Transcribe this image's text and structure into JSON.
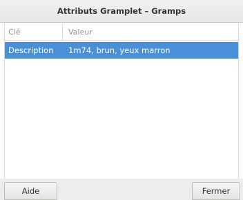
{
  "window": {
    "title": "Attributs Gramplet – Gramps"
  },
  "columns": {
    "key": "Clé",
    "value": "Valeur"
  },
  "rows": [
    {
      "key": "Description",
      "value": "1m74, brun, yeux marron",
      "selected": true
    }
  ],
  "buttons": {
    "help": "Aide",
    "close": "Fermer"
  },
  "colors": {
    "selection": "#4a90d9",
    "titlebar": "#e8e8e7"
  }
}
